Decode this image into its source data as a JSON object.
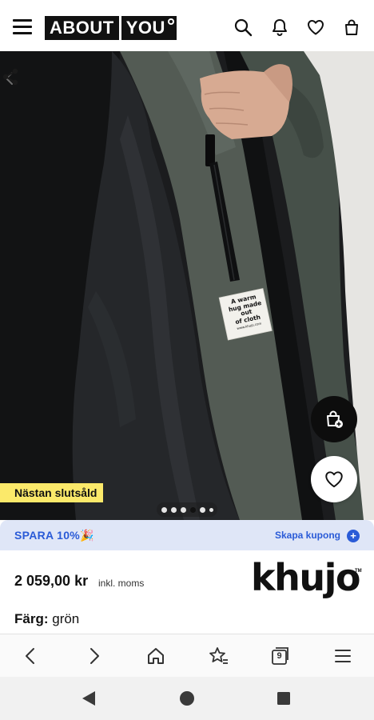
{
  "header": {
    "logo_left": "ABOUT",
    "logo_right": "YOU",
    "icons": [
      "menu-icon",
      "search-icon",
      "bell-icon",
      "heart-icon",
      "bag-icon"
    ]
  },
  "hero": {
    "label_text": [
      "A warm",
      "hug made",
      "out",
      "of cloth"
    ],
    "label_site": "www.khujo.com",
    "badge": "Nästan slutsåld",
    "carousel": {
      "count": 6,
      "active_index": 3
    }
  },
  "promo": {
    "save_text": "SPARA 10%🎉",
    "coupon_text": "Skapa kupong",
    "accent": "#2a5bd7",
    "background": "#dfe6f7"
  },
  "product": {
    "price": "2 059,00 kr",
    "tax_note": "inkl. moms",
    "brand": "khujo",
    "brand_mark": "TM",
    "color_label": "Färg:",
    "color_value": "grön",
    "badge_color": "#fbe96a"
  },
  "browser_toolbar": {
    "tab_count": "9",
    "icons": [
      "back-icon",
      "forward-icon",
      "home-icon",
      "bookmark-star-icon",
      "tabs-icon",
      "menu-icon"
    ]
  },
  "android_nav": {
    "icons": [
      "nav-back-icon",
      "nav-home-icon",
      "nav-recents-icon"
    ]
  }
}
